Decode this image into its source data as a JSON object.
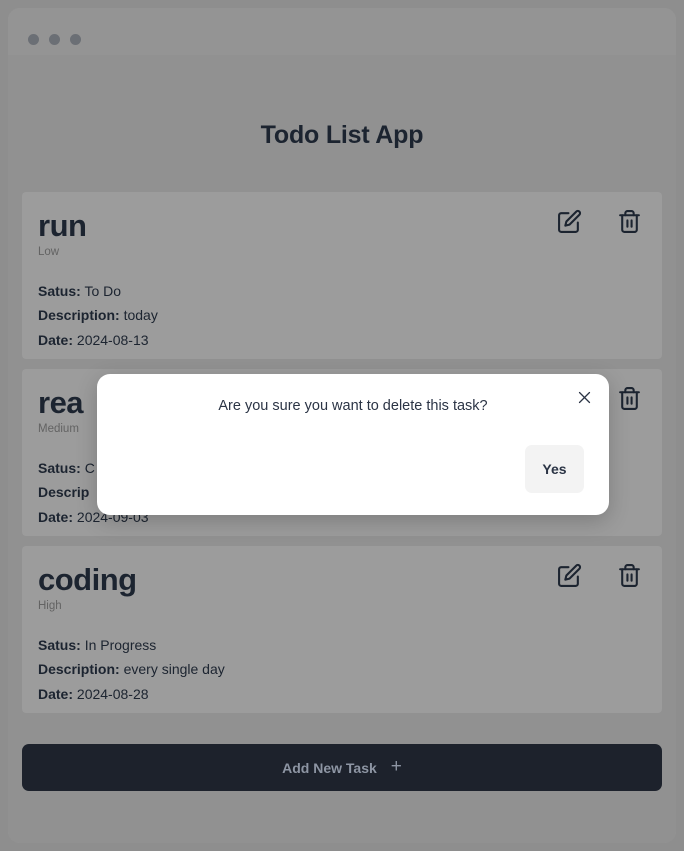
{
  "window": {
    "dots": [
      "dot-1",
      "dot-2",
      "dot-3"
    ]
  },
  "page": {
    "title": "Todo List App"
  },
  "tasks": [
    {
      "title": "run",
      "priority": "Low",
      "status_label": "Satus:",
      "status_value": "To Do",
      "description_label": "Description:",
      "description_value": "today",
      "date_label": "Date:",
      "date_value": "2024-08-13"
    },
    {
      "title": "rea",
      "priority": "Medium",
      "status_label": "Satus:",
      "status_value": "C",
      "description_label": "Descrip",
      "description_value": "",
      "date_label": "Date:",
      "date_value": "2024-09-03"
    },
    {
      "title": "coding",
      "priority": "High",
      "status_label": "Satus:",
      "status_value": "In Progress",
      "description_label": "Description:",
      "description_value": "every single day",
      "date_label": "Date:",
      "date_value": "2024-08-28"
    }
  ],
  "add_task": {
    "label": "Add New Task",
    "plus": "+"
  },
  "modal": {
    "message": "Are you sure you want to delete this task?",
    "confirm_label": "Yes",
    "close_label": "×"
  },
  "colors": {
    "page_background": "#919191",
    "card_background": "#9c9c9c",
    "text_dark": "#1c2430",
    "add_button_background": "#1d222c",
    "add_button_text": "#8d95a3",
    "modal_background": "#ffffff",
    "modal_button_background": "#f3f3f3"
  }
}
